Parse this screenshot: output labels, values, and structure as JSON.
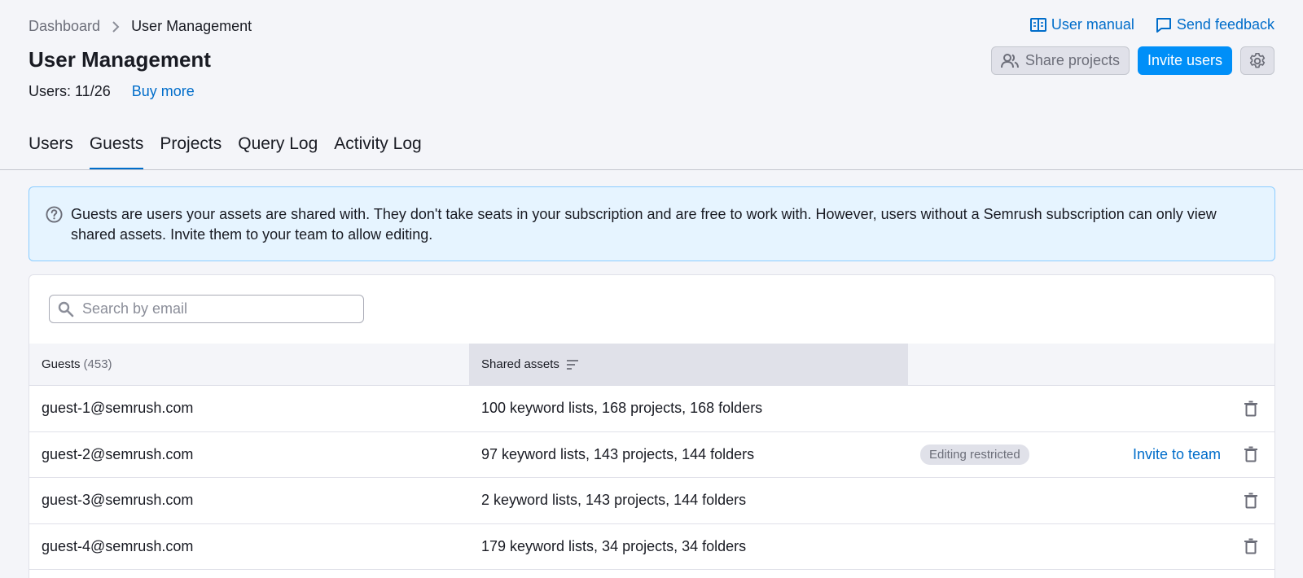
{
  "breadcrumb": {
    "parent": "Dashboard",
    "current": "User Management"
  },
  "page": {
    "title": "User Management",
    "users_count": "Users: 11/26",
    "buy_more": "Buy more"
  },
  "top_links": {
    "manual": "User manual",
    "feedback": "Send feedback"
  },
  "actions": {
    "share": "Share projects",
    "invite": "Invite users"
  },
  "tabs": [
    {
      "label": "Users",
      "active": false
    },
    {
      "label": "Guests",
      "active": true
    },
    {
      "label": "Projects",
      "active": false
    },
    {
      "label": "Query Log",
      "active": false
    },
    {
      "label": "Activity Log",
      "active": false
    }
  ],
  "info": {
    "text": "Guests are users your assets are shared with. They don't take seats in your subscription and are free to work with. However, users without a Semrush subscription can only view shared assets. Invite them to your team to allow editing."
  },
  "search": {
    "placeholder": "Search by email",
    "value": ""
  },
  "table": {
    "headers": {
      "guests": "Guests",
      "guests_count": "(453)",
      "assets": "Shared assets"
    },
    "rows": [
      {
        "email": "guest-1@semrush.com",
        "assets": "100 keyword lists, 168 projects, 168 folders",
        "badge": "",
        "invite": ""
      },
      {
        "email": "guest-2@semrush.com",
        "assets": "97 keyword lists, 143 projects, 144 folders",
        "badge": "Editing restricted",
        "invite": "Invite to team"
      },
      {
        "email": "guest-3@semrush.com",
        "assets": "2 keyword lists, 143 projects, 144 folders",
        "badge": "",
        "invite": ""
      },
      {
        "email": "guest-4@semrush.com",
        "assets": "179 keyword lists, 34 projects, 34 folders",
        "badge": "",
        "invite": ""
      }
    ]
  },
  "colors": {
    "accent": "#006dca",
    "primary_button": "#008ff8",
    "banner_bg": "#e6f4ff",
    "banner_border": "#8ccdff"
  },
  "icons": [
    "chevron-right-icon",
    "book-icon",
    "chat-icon",
    "users-icon",
    "gear-icon",
    "question-icon",
    "search-icon",
    "sort-icon",
    "trash-icon"
  ]
}
